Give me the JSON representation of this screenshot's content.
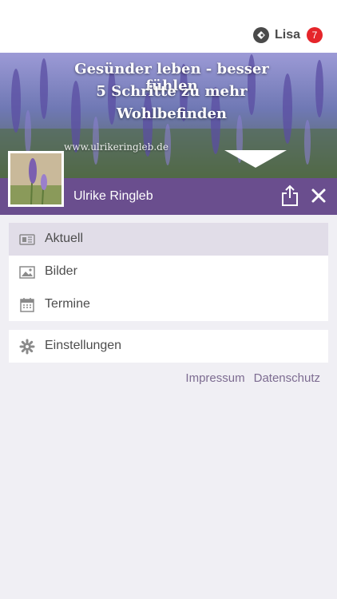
{
  "header": {
    "user_name": "Lisa",
    "notification_count": "7",
    "colors": {
      "badge": "#e5252a"
    }
  },
  "hero": {
    "line1": "Gesünder leben - besser fühlen",
    "line2": "5 Schritte zu mehr",
    "line3": "Wohlbefinden",
    "url": "www.ulrikeringleb.de"
  },
  "profile": {
    "name": "Ulrike Ringleb",
    "bar_color": "#6a4e8e"
  },
  "menu": {
    "items": [
      {
        "label": "Aktuell",
        "icon": "newspaper-icon",
        "active": true
      },
      {
        "label": "Bilder",
        "icon": "image-icon",
        "active": false
      },
      {
        "label": "Termine",
        "icon": "calendar-icon",
        "active": false
      }
    ],
    "settings": {
      "label": "Einstellungen",
      "icon": "gear-icon"
    }
  },
  "footer": {
    "impressum": "Impressum",
    "datenschutz": "Datenschutz",
    "link_color": "#7d6c91"
  }
}
